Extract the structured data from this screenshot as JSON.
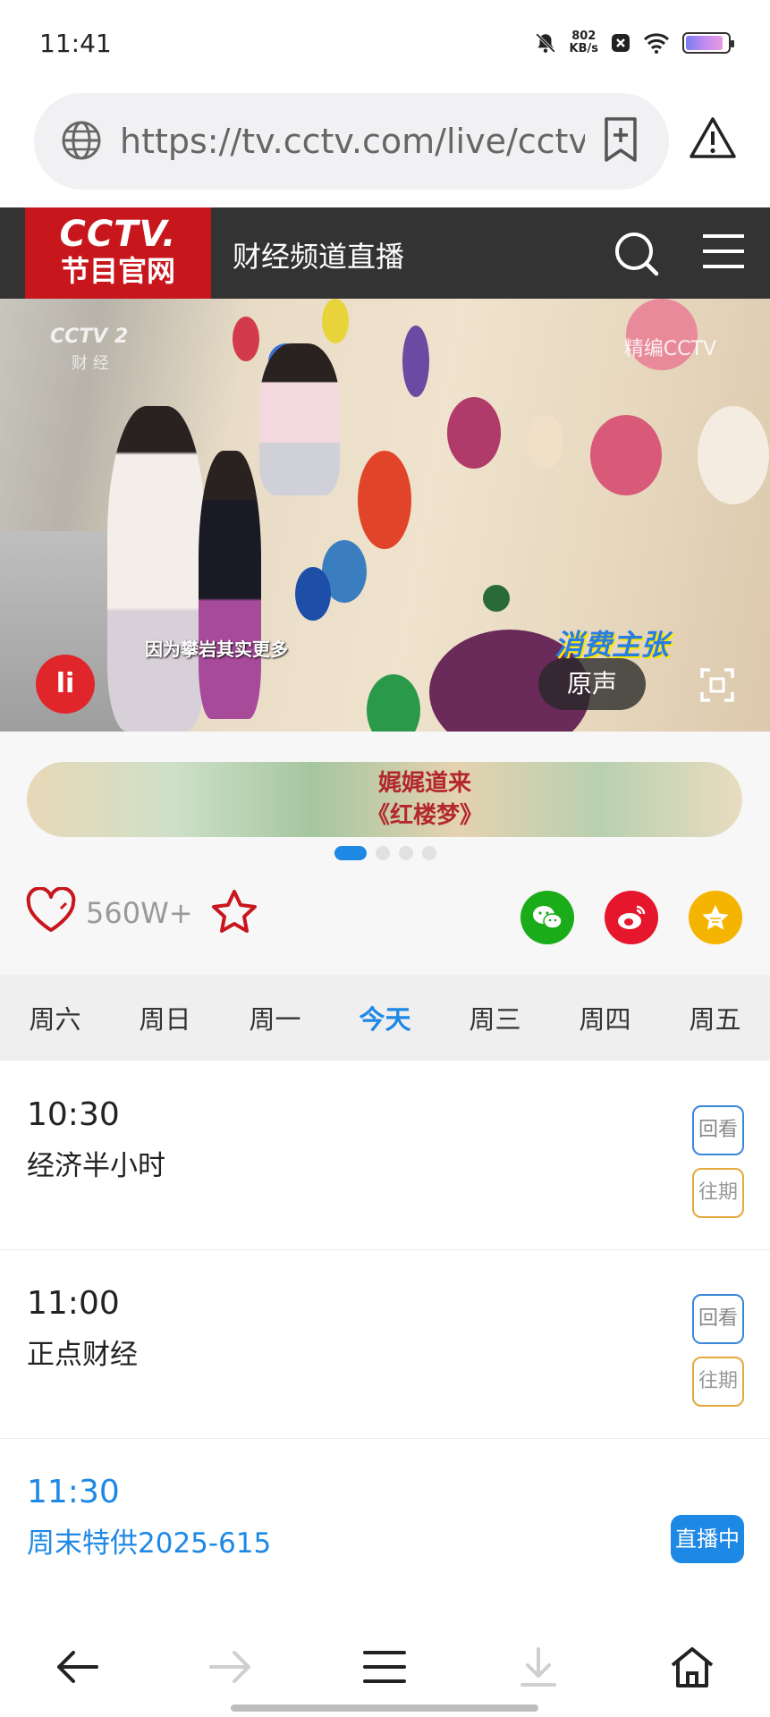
{
  "status_bar": {
    "time": "11:41",
    "net_speed_value": "802",
    "net_speed_unit": "KB/s",
    "battery_level": 0.9
  },
  "browser": {
    "url": "https://tv.cctv.com/live/cctv…"
  },
  "header": {
    "logo_top": "CCTV.",
    "logo_bottom": "节目官网",
    "channel_title": "财经频道直播"
  },
  "video": {
    "channel_logo": "CCTV 2",
    "channel_logo_sub": "财 经",
    "watermark": "精编CCTV",
    "subtitle": "因为攀岩其实更多",
    "show_logo": "消费主张",
    "play_logo": "li",
    "audio_button": "原声"
  },
  "banner": {
    "line1": "娓娓道来",
    "line2": "《红楼梦》",
    "active_index": 0,
    "total": 4
  },
  "actions": {
    "like_count": "560W+"
  },
  "days": [
    {
      "label": "周六",
      "active": false
    },
    {
      "label": "周日",
      "active": false
    },
    {
      "label": "周一",
      "active": false
    },
    {
      "label": "今天",
      "active": true
    },
    {
      "label": "周三",
      "active": false
    },
    {
      "label": "周四",
      "active": false
    },
    {
      "label": "周五",
      "active": false
    }
  ],
  "programs": [
    {
      "time": "10:30",
      "name": "经济半小时",
      "replay_label": "回看",
      "past_label": "往期"
    },
    {
      "time": "11:00",
      "name": "正点财经",
      "replay_label": "回看",
      "past_label": "往期"
    },
    {
      "time": "11:30",
      "name": "周末特供2025-615",
      "live_label": "直播中"
    }
  ],
  "colors": {
    "accent": "#1e88e5",
    "brand": "#c8161d",
    "header_bg": "#333333",
    "past_border": "#e3a93d"
  }
}
